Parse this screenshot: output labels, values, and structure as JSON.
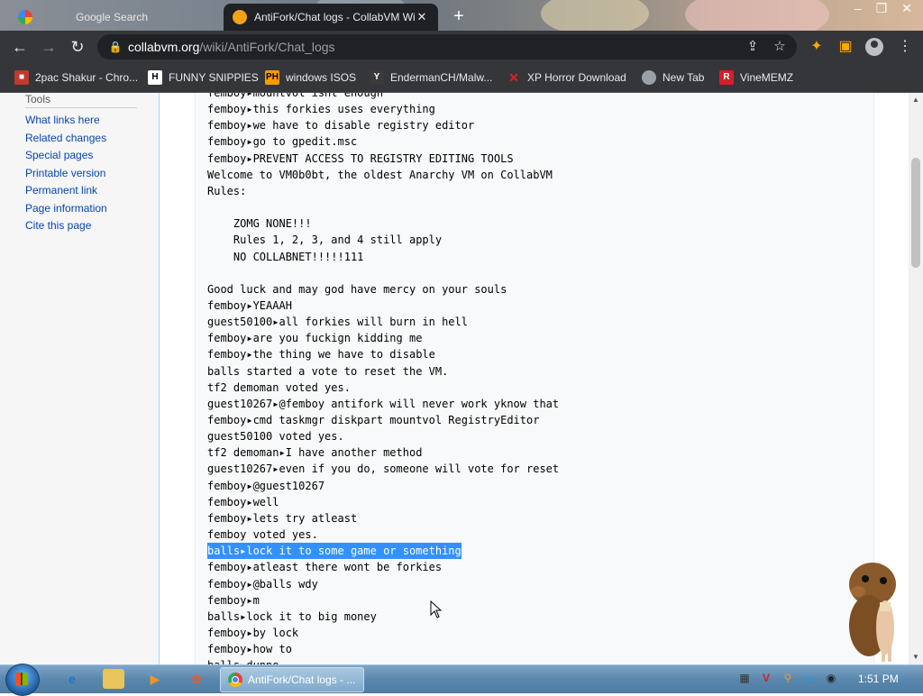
{
  "browser": {
    "tabs": [
      {
        "title": "Google Search",
        "active": false
      },
      {
        "title": "AntiFork/Chat logs - CollabVM Wiki",
        "active": true
      }
    ],
    "new_tab_symbol": "+",
    "omnibox": {
      "host": "collabvm.org",
      "path": "/wiki/AntiFork/Chat_logs"
    },
    "bookmarks": [
      {
        "label": "2pac Shakur - Chro...",
        "icon": "bookmark-2pac-icon",
        "color": "#c0392b"
      },
      {
        "label": "FUNNY SNIPPIES",
        "icon": "history-h-icon",
        "color": "#000000"
      },
      {
        "label": "windows ISOS",
        "icon": "ph-logo-icon",
        "color": "#ff9900"
      },
      {
        "label": "EndermanCH/Malw...",
        "icon": "yp-icon",
        "color": "#3a3a3a"
      },
      {
        "label": "XP Horror Download",
        "icon": "red-x-icon",
        "color": "#e02020"
      },
      {
        "label": "New Tab",
        "icon": "globe-icon",
        "color": "#9aa0a6"
      },
      {
        "label": "VineMEMZ",
        "icon": "r-logo-icon",
        "color": "#d0202a"
      }
    ]
  },
  "sidebar": {
    "heading": "Tools",
    "links": [
      "What links here",
      "Related changes",
      "Special pages",
      "Printable version",
      "Permanent link",
      "Page information",
      "Cite this page"
    ]
  },
  "chat_log": [
    {
      "text": "femboy▸mountvol isnt enough",
      "selected": false
    },
    {
      "text": "femboy▸this forkies uses everything",
      "selected": false
    },
    {
      "text": "femboy▸we have to disable registry editor",
      "selected": false
    },
    {
      "text": "femboy▸go to gpedit.msc",
      "selected": false
    },
    {
      "text": "femboy▸PREVENT ACCESS TO REGISTRY EDITING TOOLS",
      "selected": false
    },
    {
      "text": "Welcome to VM0b0bt, the oldest Anarchy VM on CollabVM",
      "selected": false
    },
    {
      "text": "Rules:",
      "selected": false
    },
    {
      "text": "",
      "selected": false
    },
    {
      "text": "    ZOMG NONE!!!",
      "selected": false
    },
    {
      "text": "    Rules 1, 2, 3, and 4 still apply",
      "selected": false
    },
    {
      "text": "    NO COLLABNET!!!!!111",
      "selected": false
    },
    {
      "text": "",
      "selected": false
    },
    {
      "text": "Good luck and may god have mercy on your souls",
      "selected": false
    },
    {
      "text": "femboy▸YEAAAH",
      "selected": false
    },
    {
      "text": "guest50100▸all forkies will burn in hell",
      "selected": false
    },
    {
      "text": "femboy▸are you fuckign kidding me",
      "selected": false
    },
    {
      "text": "femboy▸the thing we have to disable",
      "selected": false
    },
    {
      "text": "balls started a vote to reset the VM.",
      "selected": false
    },
    {
      "text": "tf2 demoman voted yes.",
      "selected": false
    },
    {
      "text": "guest10267▸@femboy antifork will never work yknow that",
      "selected": false
    },
    {
      "text": "femboy▸cmd taskmgr diskpart mountvol RegistryEditor",
      "selected": false
    },
    {
      "text": "guest50100 voted yes.",
      "selected": false
    },
    {
      "text": "tf2 demoman▸I have another method",
      "selected": false
    },
    {
      "text": "guest10267▸even if you do, someone will vote for reset",
      "selected": false
    },
    {
      "text": "femboy▸@guest10267",
      "selected": false
    },
    {
      "text": "femboy▸well",
      "selected": false
    },
    {
      "text": "femboy▸lets try atleast",
      "selected": false
    },
    {
      "text": "femboy voted yes.",
      "selected": false
    },
    {
      "text": "balls▸lock it to some game or something",
      "selected": true
    },
    {
      "text": "femboy▸atleast there wont be forkies",
      "selected": false
    },
    {
      "text": "femboy▸@balls wdy",
      "selected": false
    },
    {
      "text": "femboy▸m",
      "selected": false
    },
    {
      "text": "balls▸lock it to big money",
      "selected": false
    },
    {
      "text": "femboy▸by lock",
      "selected": false
    },
    {
      "text": "femboy▸how to",
      "selected": false
    },
    {
      "text": "balls▸dunno",
      "selected": false
    }
  ],
  "taskbar": {
    "chrome_task": "AntiFork/Chat logs - ...",
    "clock": "1:51 PM"
  }
}
